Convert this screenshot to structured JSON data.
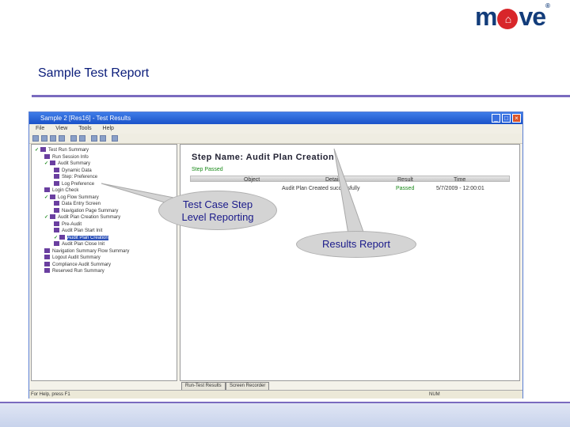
{
  "header": {
    "logo_text_left": "m",
    "logo_text_right": "ve",
    "logo_o": "⌂",
    "logo_reg": "®",
    "slide_title": "Sample Test Report"
  },
  "window": {
    "title": "Sample 2 [Res16] - Test Results",
    "menu": [
      "File",
      "View",
      "Tools",
      "Help"
    ],
    "buttons": {
      "minimize": "_",
      "maximize": "□",
      "close": "×"
    }
  },
  "tree": {
    "items": [
      {
        "label": "Test Run Summary",
        "depth": 0,
        "check": true
      },
      {
        "label": "Run Session Info",
        "depth": 1,
        "check": false
      },
      {
        "label": "Audit Summary",
        "depth": 1,
        "check": true
      },
      {
        "label": "Dynamic Data",
        "depth": 2,
        "check": false
      },
      {
        "label": "Step: Preference",
        "depth": 2,
        "check": false
      },
      {
        "label": "Log Preference",
        "depth": 2,
        "check": false
      },
      {
        "label": "Login Check",
        "depth": 1,
        "check": false
      },
      {
        "label": "Log Flow Summary",
        "depth": 1,
        "check": true
      },
      {
        "label": "Data Entry Screen",
        "depth": 2,
        "check": false
      },
      {
        "label": "Navigation Page Summary",
        "depth": 2,
        "check": false
      },
      {
        "label": "Audit Plan Creation Summary",
        "depth": 1,
        "check": true
      },
      {
        "label": "Pre-Audit",
        "depth": 2,
        "check": false
      },
      {
        "label": "Audit Plan Start Init",
        "depth": 2,
        "check": false
      },
      {
        "label": "Audit Plan Creation",
        "depth": 2,
        "check": true,
        "selected": true
      },
      {
        "label": "Audit Plan Close Init",
        "depth": 2,
        "check": false
      },
      {
        "label": "Navigation Summary Flow Summary",
        "depth": 1,
        "check": false
      },
      {
        "label": "Logout Audit Summary",
        "depth": 1,
        "check": false
      },
      {
        "label": "Compliance Audit Summary",
        "depth": 1,
        "check": false
      },
      {
        "label": "Reserved Run Summary",
        "depth": 1,
        "check": false
      }
    ]
  },
  "results": {
    "step_name": "Step Name: Audit Plan Creation",
    "status": "Step Passed",
    "columns": [
      "Object",
      "Details",
      "Result",
      "Time"
    ],
    "row": {
      "object": "",
      "details": "Audit Plan Created successfully",
      "result": "Passed",
      "time": "5/7/2009 - 12:00:01"
    }
  },
  "tabs": [
    "Run-Test Results",
    "Screen Recorder"
  ],
  "status_bar": {
    "left": "For Help, press F1",
    "right": "NUM"
  },
  "callouts": {
    "test_case_line1": "Test Case Step",
    "test_case_line2": "Level Reporting",
    "results": "Results Report"
  },
  "colors": {
    "brand_blue": "#123c7a",
    "brand_red": "#d8262a",
    "accent_line": "#7a6bbf",
    "title_text": "#0a1c7a",
    "pass_green": "#1a8a1a"
  }
}
